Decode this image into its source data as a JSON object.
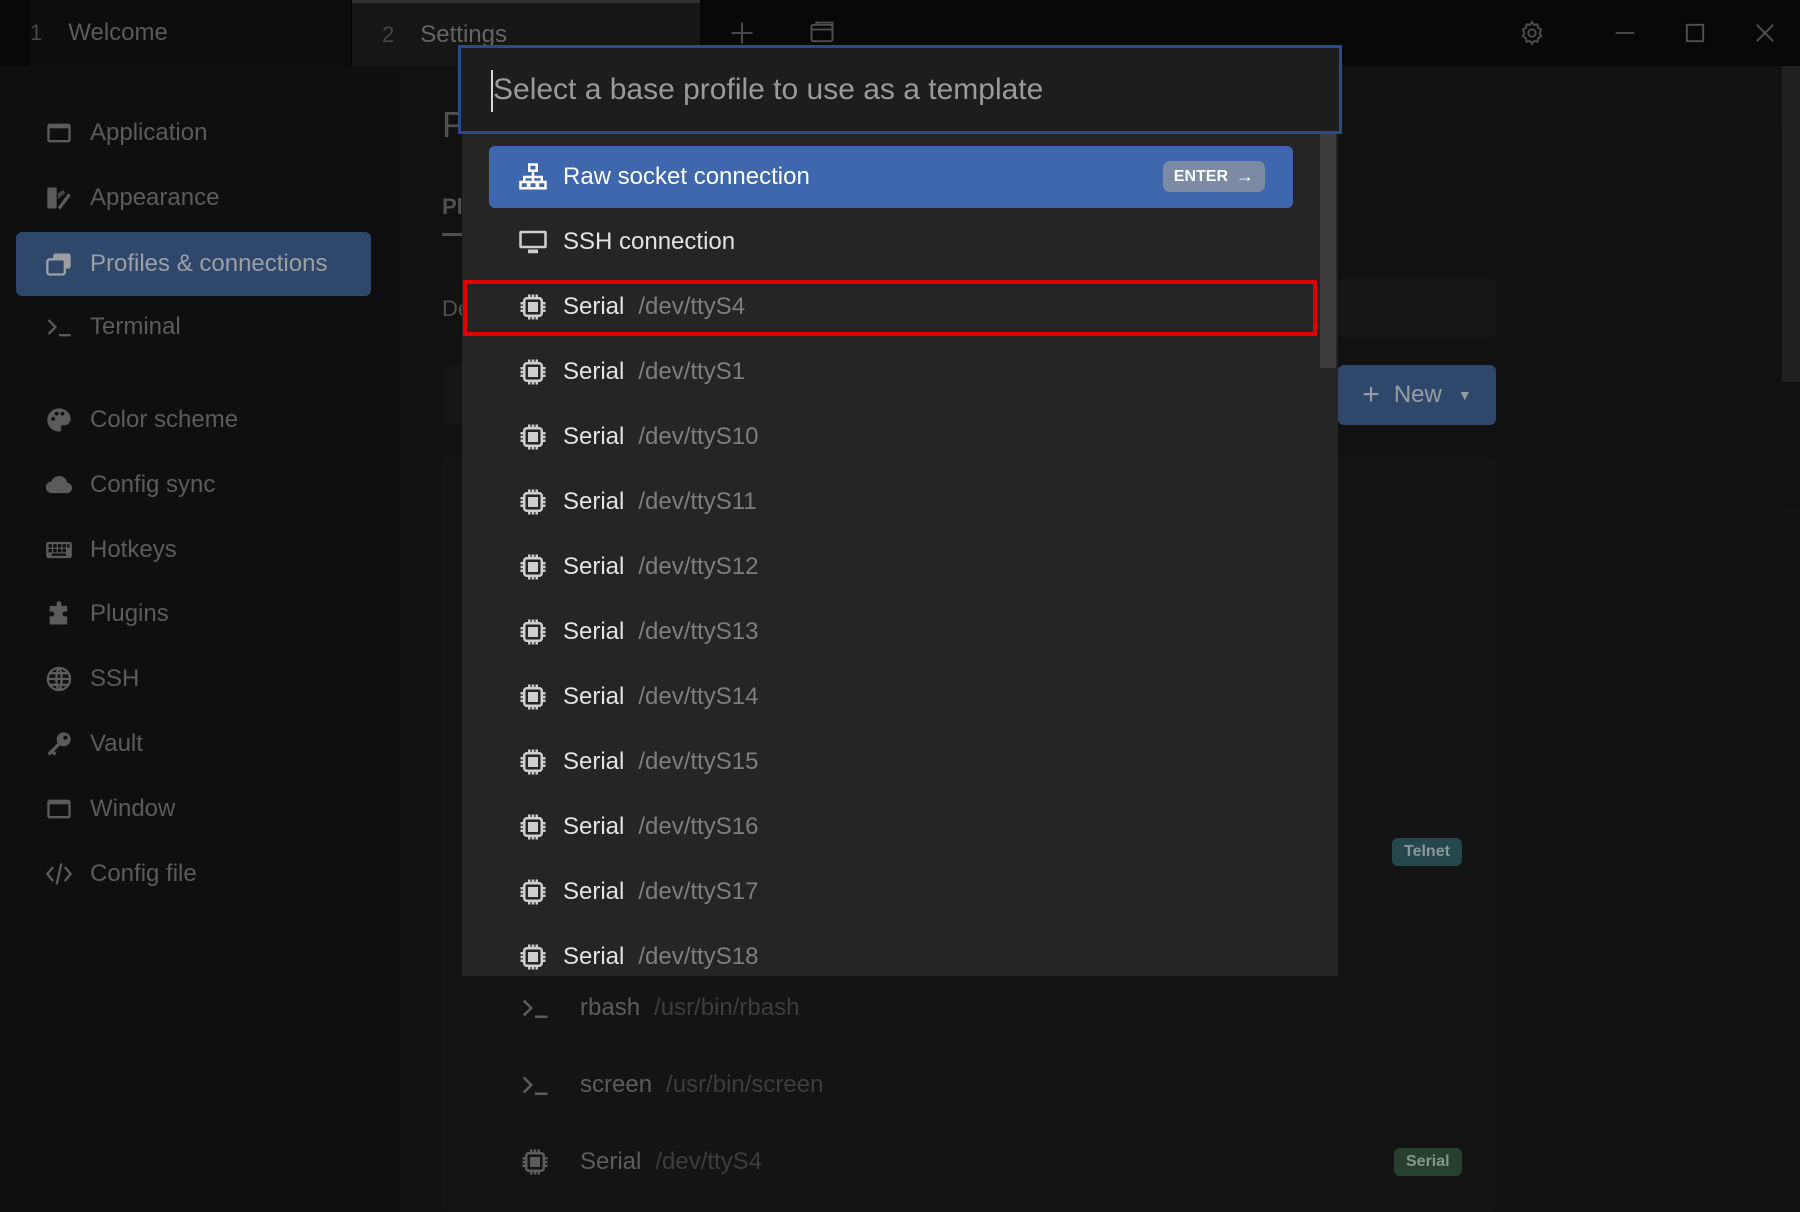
{
  "titlebar": {
    "tabs": [
      {
        "num": "1",
        "label": "Welcome"
      },
      {
        "num": "2",
        "label": "Settings"
      }
    ],
    "icons": [
      "plus-icon",
      "window-icon",
      "gear-icon",
      "minimize-icon",
      "maximize-icon",
      "close-icon"
    ]
  },
  "sidebar": {
    "items": [
      {
        "label": "Application",
        "icon": "window-icon"
      },
      {
        "label": "Appearance",
        "icon": "palette-brush-icon"
      },
      {
        "label": "Profiles & connections",
        "icon": "profiles-icon",
        "active": true
      },
      {
        "label": "Terminal",
        "icon": "terminal-icon"
      },
      {
        "label": "Color scheme",
        "icon": "palette-icon"
      },
      {
        "label": "Config sync",
        "icon": "cloud-icon"
      },
      {
        "label": "Hotkeys",
        "icon": "keyboard-icon"
      },
      {
        "label": "Plugins",
        "icon": "puzzle-icon"
      },
      {
        "label": "SSH",
        "icon": "globe-icon"
      },
      {
        "label": "Vault",
        "icon": "key-icon"
      },
      {
        "label": "Window",
        "icon": "window-icon"
      },
      {
        "label": "Config file",
        "icon": "code-icon"
      }
    ]
  },
  "background": {
    "heading_fragment": "P",
    "tab_fragment": "Pl",
    "field_fragment": "De",
    "new_button": "New",
    "rows": [
      {
        "label": "rbash",
        "sub": "/usr/bin/rbash",
        "icon": "terminal-icon"
      },
      {
        "label": "screen",
        "sub": "/usr/bin/screen",
        "icon": "terminal-icon"
      },
      {
        "label": "Serial",
        "sub": "/dev/ttyS4",
        "icon": "chip-icon"
      }
    ],
    "badges": {
      "telnet": "Telnet",
      "serial": "Serial"
    }
  },
  "modal": {
    "search_placeholder": "Select a base profile to use as a template",
    "enter_label": "ENTER",
    "items": [
      {
        "label": "Raw socket connection",
        "sub": "",
        "icon": "network-icon"
      },
      {
        "label": "SSH connection",
        "sub": "",
        "icon": "monitor-icon"
      },
      {
        "label": "Serial",
        "sub": "/dev/ttyS4",
        "icon": "chip-icon"
      },
      {
        "label": "Serial",
        "sub": "/dev/ttyS1",
        "icon": "chip-icon"
      },
      {
        "label": "Serial",
        "sub": "/dev/ttyS10",
        "icon": "chip-icon"
      },
      {
        "label": "Serial",
        "sub": "/dev/ttyS11",
        "icon": "chip-icon"
      },
      {
        "label": "Serial",
        "sub": "/dev/ttyS12",
        "icon": "chip-icon"
      },
      {
        "label": "Serial",
        "sub": "/dev/ttyS13",
        "icon": "chip-icon"
      },
      {
        "label": "Serial",
        "sub": "/dev/ttyS14",
        "icon": "chip-icon"
      },
      {
        "label": "Serial",
        "sub": "/dev/ttyS15",
        "icon": "chip-icon"
      },
      {
        "label": "Serial",
        "sub": "/dev/ttyS16",
        "icon": "chip-icon"
      },
      {
        "label": "Serial",
        "sub": "/dev/ttyS17",
        "icon": "chip-icon"
      },
      {
        "label": "Serial",
        "sub": "/dev/ttyS18",
        "icon": "chip-icon"
      }
    ]
  },
  "colors": {
    "accent": "#4a6ea6",
    "selected_item": "#3f67ad",
    "highlight_outline": "#e00000"
  }
}
